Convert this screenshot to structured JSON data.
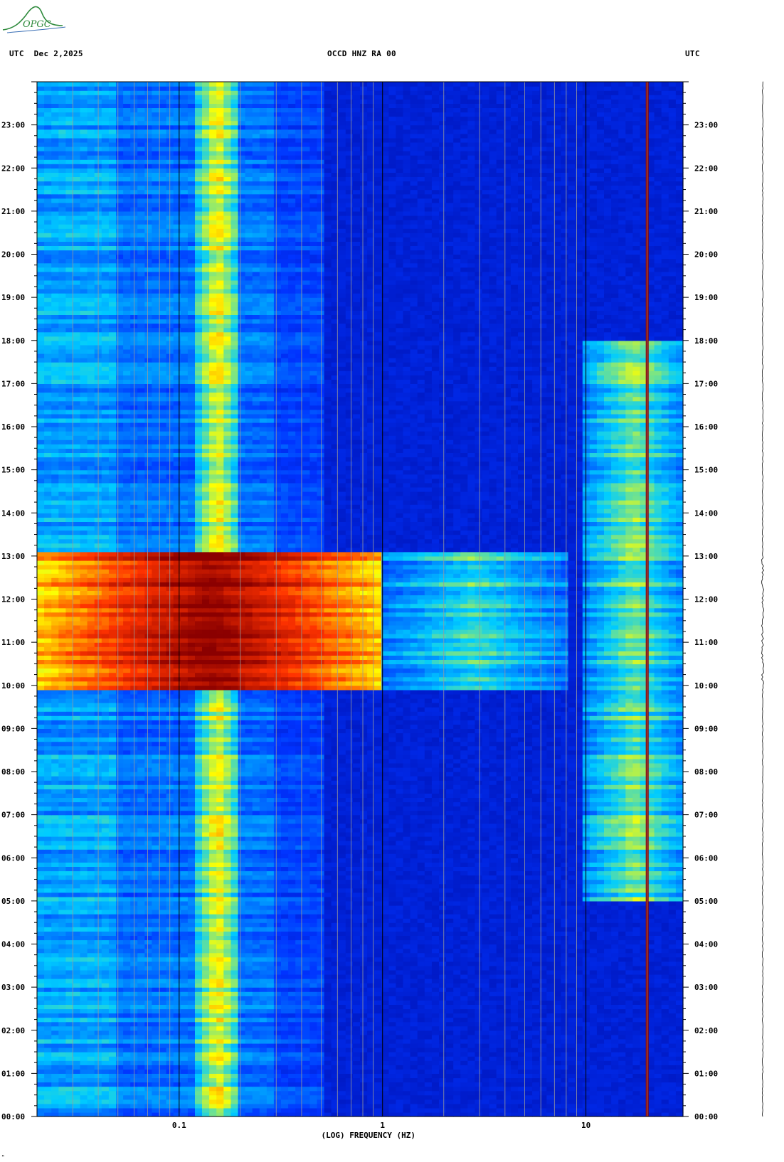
{
  "logo": {
    "text": "OPGC",
    "color": "#2e8a3c"
  },
  "header": {
    "left": "UTC  Dec 2,2025",
    "center": "OCCD HNZ RA 00",
    "right": "UTC"
  },
  "footer_mark": "ᴹ",
  "chart_data": {
    "type": "heatmap",
    "title": "OCCD HNZ RA 00",
    "date": "Dec 2,2025",
    "xlabel": "(LOG) FREQUENCY (HZ)",
    "ylabel": "UTC",
    "xscale": "log",
    "xlim": [
      0.02,
      30
    ],
    "x_ticks": [
      {
        "value": 0.1,
        "label": "0.1"
      },
      {
        "value": 1,
        "label": "1"
      },
      {
        "value": 10,
        "label": "10"
      }
    ],
    "ylim_hours": [
      0,
      24
    ],
    "y_ticks": [
      "00:00",
      "01:00",
      "02:00",
      "03:00",
      "04:00",
      "05:00",
      "06:00",
      "07:00",
      "08:00",
      "09:00",
      "10:00",
      "11:00",
      "12:00",
      "13:00",
      "14:00",
      "15:00",
      "16:00",
      "17:00",
      "18:00",
      "19:00",
      "20:00",
      "21:00",
      "22:00",
      "23:00"
    ],
    "colormap": [
      "#00008b",
      "#0033ff",
      "#00ccff",
      "#ffff00",
      "#ff3300",
      "#8b0000"
    ],
    "features": [
      {
        "name": "microseism band",
        "freq_range_hz": [
          0.12,
          0.2
        ],
        "time_range_h": [
          0,
          24
        ],
        "level": 0.6
      },
      {
        "name": "broadband energy",
        "freq_range_hz": [
          0.02,
          1.0
        ],
        "time_range_h": [
          9.9,
          13.05
        ],
        "level": 1.0
      },
      {
        "name": "broadband energy tail",
        "freq_range_hz": [
          1.0,
          8.0
        ],
        "time_range_h": [
          9.9,
          13.05
        ],
        "level": 0.45
      },
      {
        "name": "constant tonal line",
        "freq_hz": 20,
        "time_range_h": [
          0,
          24
        ],
        "level": 1.0
      },
      {
        "name": "high-frequency noise",
        "freq_range_hz": [
          10,
          30
        ],
        "time_range_h": [
          5,
          18
        ],
        "level": 0.5
      }
    ],
    "grid": true
  }
}
